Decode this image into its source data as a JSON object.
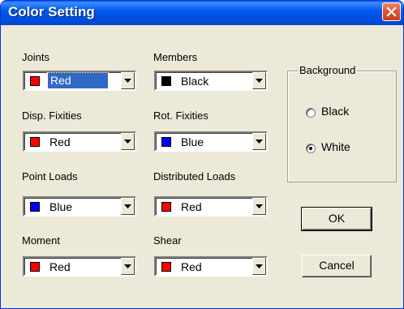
{
  "window": {
    "title": "Color Setting"
  },
  "fields": [
    {
      "label": "Joints",
      "value": "Red",
      "color": "#ff0000"
    },
    {
      "label": "Members",
      "value": "Black",
      "color": "#000000"
    },
    {
      "label": "Disp.  Fixities",
      "value": "Red",
      "color": "#ff0000"
    },
    {
      "label": "Rot. Fixities",
      "value": "Blue",
      "color": "#0000ff"
    },
    {
      "label": "Point Loads",
      "value": "Blue",
      "color": "#0000ff"
    },
    {
      "label": "Distributed Loads",
      "value": "Red",
      "color": "#ff0000"
    },
    {
      "label": "Moment",
      "value": "Red",
      "color": "#ff0000"
    },
    {
      "label": "Shear",
      "value": "Red",
      "color": "#ff0000"
    }
  ],
  "background": {
    "label": "Background",
    "options": [
      {
        "label": "Black",
        "selected": false
      },
      {
        "label": "White",
        "selected": true
      }
    ]
  },
  "buttons": {
    "ok": "OK",
    "cancel": "Cancel"
  },
  "accent": "#316ac5",
  "title_bar_color": "#0058ee",
  "close_button_color": "#e0552f"
}
